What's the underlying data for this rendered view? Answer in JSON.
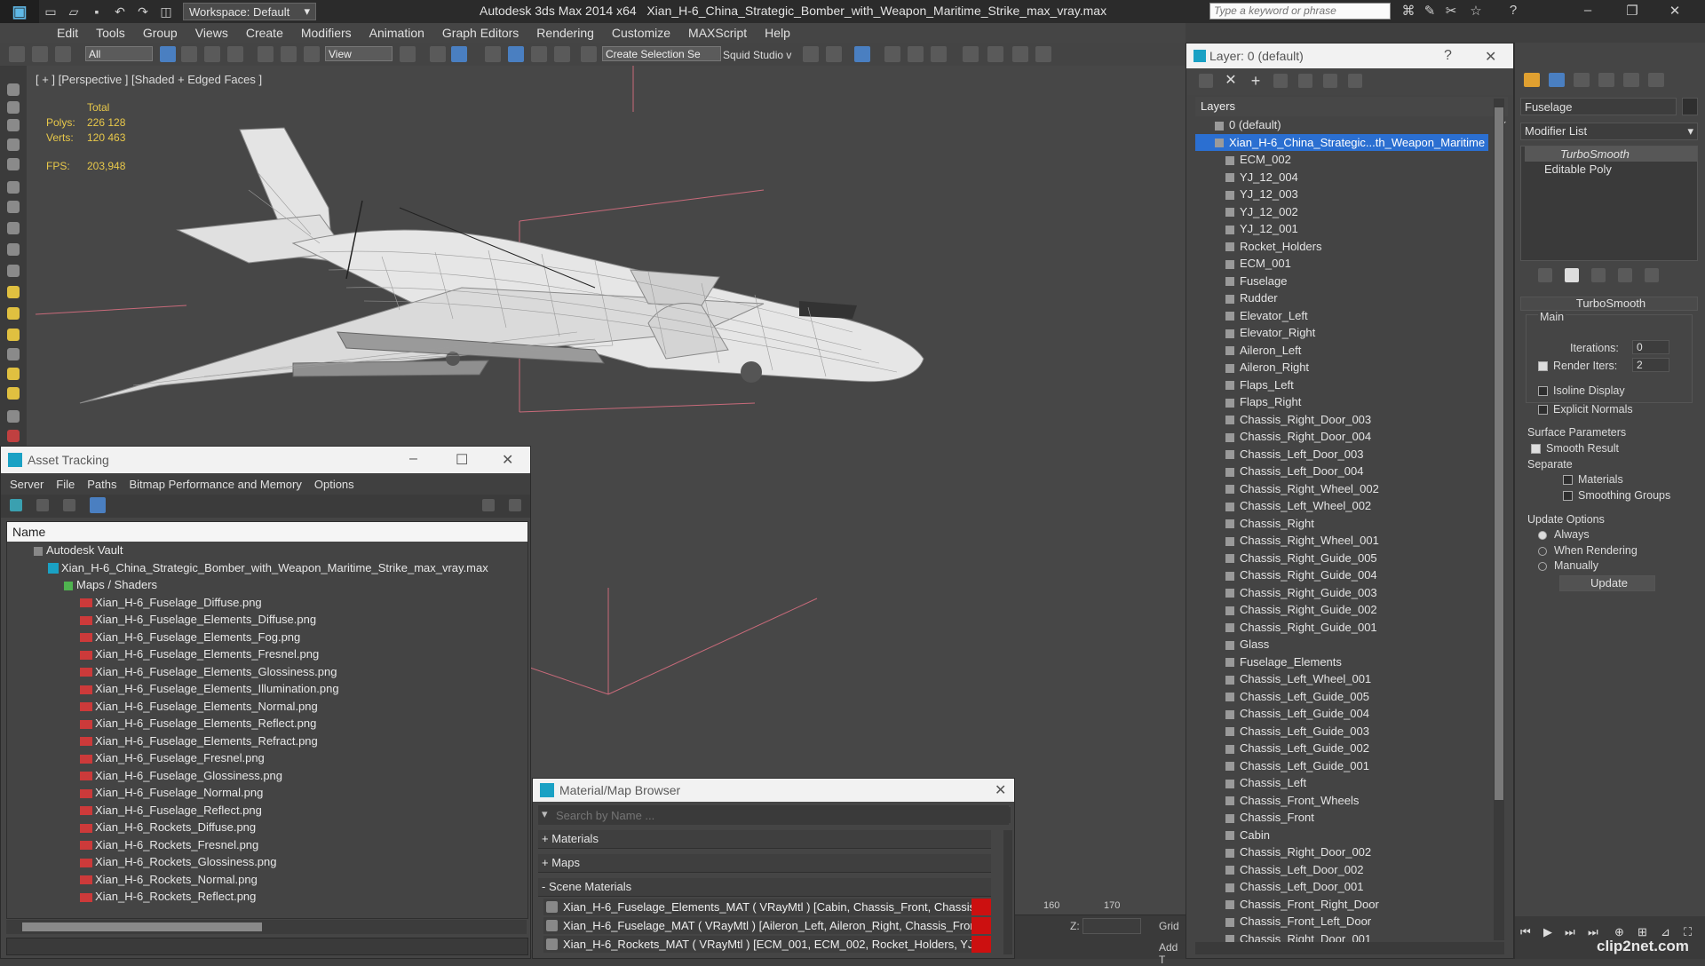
{
  "titlebar": {
    "workspace": "Workspace: Default",
    "app": "Autodesk 3ds Max  2014 x64",
    "file": "Xian_H-6_China_Strategic_Bomber_with_Weapon_Maritime_Strike_max_vray.max",
    "search_placeholder": "Type a keyword or phrase"
  },
  "menu": [
    "Edit",
    "Tools",
    "Group",
    "Views",
    "Create",
    "Modifiers",
    "Animation",
    "Graph Editors",
    "Rendering",
    "Customize",
    "MAXScript",
    "Help"
  ],
  "toolbar": {
    "filter": "All",
    "refcoord": "View",
    "selection_set": "Create Selection Se",
    "squid": "Squid Studio v"
  },
  "viewport": {
    "label": "[ + ] [Perspective ] [Shaded + Edged Faces ]",
    "stats_header": "Total",
    "polys_label": "Polys:",
    "polys": "226 128",
    "verts_label": "Verts:",
    "verts": "120 463",
    "fps_label": "FPS:",
    "fps": "203,948"
  },
  "asset_tracking": {
    "title": "Asset Tracking",
    "menu": [
      "Server",
      "File",
      "Paths",
      "Bitmap Performance and Memory",
      "Options"
    ],
    "column": "Name",
    "vault": "Autodesk Vault",
    "scene_file": "Xian_H-6_China_Strategic_Bomber_with_Weapon_Maritime_Strike_max_vray.max",
    "maps_group": "Maps / Shaders",
    "maps": [
      "Xian_H-6_Fuselage_Diffuse.png",
      "Xian_H-6_Fuselage_Elements_Diffuse.png",
      "Xian_H-6_Fuselage_Elements_Fog.png",
      "Xian_H-6_Fuselage_Elements_Fresnel.png",
      "Xian_H-6_Fuselage_Elements_Glossiness.png",
      "Xian_H-6_Fuselage_Elements_Illumination.png",
      "Xian_H-6_Fuselage_Elements_Normal.png",
      "Xian_H-6_Fuselage_Elements_Reflect.png",
      "Xian_H-6_Fuselage_Elements_Refract.png",
      "Xian_H-6_Fuselage_Fresnel.png",
      "Xian_H-6_Fuselage_Glossiness.png",
      "Xian_H-6_Fuselage_Normal.png",
      "Xian_H-6_Fuselage_Reflect.png",
      "Xian_H-6_Rockets_Diffuse.png",
      "Xian_H-6_Rockets_Fresnel.png",
      "Xian_H-6_Rockets_Glossiness.png",
      "Xian_H-6_Rockets_Normal.png",
      "Xian_H-6_Rockets_Reflect.png"
    ]
  },
  "material_browser": {
    "title": "Material/Map Browser",
    "search_placeholder": "Search by Name ...",
    "sections": [
      "+ Materials",
      "+ Maps",
      "- Scene Materials"
    ],
    "scene_materials": [
      "Xian_H-6_Fuselage_Elements_MAT ( VRayMtl ) [Cabin, Chassis_Front, Chassis_...",
      "Xian_H-6_Fuselage_MAT ( VRayMtl ) [Aileron_Left, Aileron_Right, Chassis_Fron...",
      "Xian_H-6_Rockets_MAT ( VRayMtl ) [ECM_001, ECM_002, Rocket_Holders, YJ_..."
    ]
  },
  "layers": {
    "title": "Layer: 0 (default)",
    "header": "Layers",
    "default_layer": "0 (default)",
    "selected_layer": "Xian_H-6_China_Strategic...th_Weapon_Maritime",
    "objects": [
      "ECM_002",
      "YJ_12_004",
      "YJ_12_003",
      "YJ_12_002",
      "YJ_12_001",
      "Rocket_Holders",
      "ECM_001",
      "Fuselage",
      "Rudder",
      "Elevator_Left",
      "Elevator_Right",
      "Aileron_Left",
      "Aileron_Right",
      "Flaps_Left",
      "Flaps_Right",
      "Chassis_Right_Door_003",
      "Chassis_Right_Door_004",
      "Chassis_Left_Door_003",
      "Chassis_Left_Door_004",
      "Chassis_Right_Wheel_002",
      "Chassis_Left_Wheel_002",
      "Chassis_Right",
      "Chassis_Right_Wheel_001",
      "Chassis_Right_Guide_005",
      "Chassis_Right_Guide_004",
      "Chassis_Right_Guide_003",
      "Chassis_Right_Guide_002",
      "Chassis_Right_Guide_001",
      "Glass",
      "Fuselage_Elements",
      "Chassis_Left_Wheel_001",
      "Chassis_Left_Guide_005",
      "Chassis_Left_Guide_004",
      "Chassis_Left_Guide_003",
      "Chassis_Left_Guide_002",
      "Chassis_Left_Guide_001",
      "Chassis_Left",
      "Chassis_Front_Wheels",
      "Chassis_Front",
      "Cabin",
      "Chassis_Right_Door_002",
      "Chassis_Left_Door_002",
      "Chassis_Left_Door_001",
      "Chassis_Front_Right_Door",
      "Chassis_Front_Left_Door",
      "Chassis_Right_Door_001"
    ]
  },
  "command_panel": {
    "object_name": "Fuselage",
    "modifier_list": "Modifier List",
    "stack": [
      "TurboSmooth",
      "Editable Poly"
    ],
    "rollout": "TurboSmooth",
    "main": "Main",
    "iterations_label": "Iterations:",
    "iterations": "0",
    "render_iters_label": "Render Iters:",
    "render_iters": "2",
    "isoline": "Isoline Display",
    "explicit_normals": "Explicit Normals",
    "surface_params": "Surface Parameters",
    "smooth_result": "Smooth Result",
    "separate": "Separate",
    "materials": "Materials",
    "smoothing_groups": "Smoothing Groups",
    "update_options": "Update Options",
    "always": "Always",
    "when_rendering": "When Rendering",
    "manually": "Manually",
    "update_button": "Update"
  },
  "timeline": {
    "tick_160": "160",
    "tick_170": "170",
    "z_label": "Z:",
    "grid_label": "Grid",
    "add_label": "Add T"
  },
  "watermark": "clip2net.com"
}
